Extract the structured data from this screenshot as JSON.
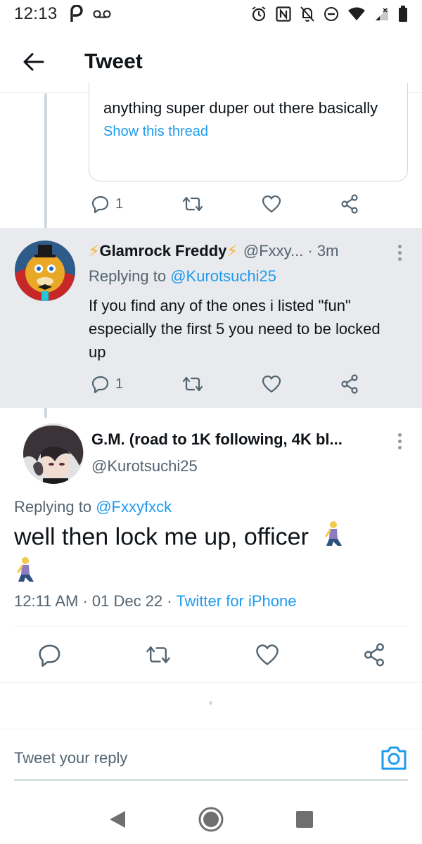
{
  "status_bar": {
    "time": "12:13"
  },
  "header": {
    "title": "Tweet"
  },
  "quoted": {
    "text": "anything super duper out there basically",
    "show_thread": "Show this thread",
    "reply_count": "1"
  },
  "reply1": {
    "name_bolt_left": "⚡",
    "name": "Glamrock Freddy",
    "name_bolt_right": "⚡",
    "handle": "@Fxxy... · 3m",
    "replying_prefix": "Replying to ",
    "replying_to": "@Kurotsuchi25",
    "text": "If you find any of the ones i listed \"fun\" especially the first 5 you need to be locked up",
    "reply_count": "1"
  },
  "main_tweet": {
    "name": "G.M. (road to 1K following, 4K bl...",
    "handle": "@Kurotsuchi25",
    "replying_prefix": "Replying to ",
    "replying_to": "@Fxxyfxck",
    "text": "well then lock me up, officer",
    "timestamp": "12:11 AM · 01 Dec 22 · ",
    "source": "Twitter for iPhone"
  },
  "reply_bar": {
    "placeholder": "Tweet your reply"
  },
  "colors": {
    "accent": "#1d9bf0",
    "bolt": "#ffad1f",
    "highlight_bg": "#e8eaed"
  }
}
